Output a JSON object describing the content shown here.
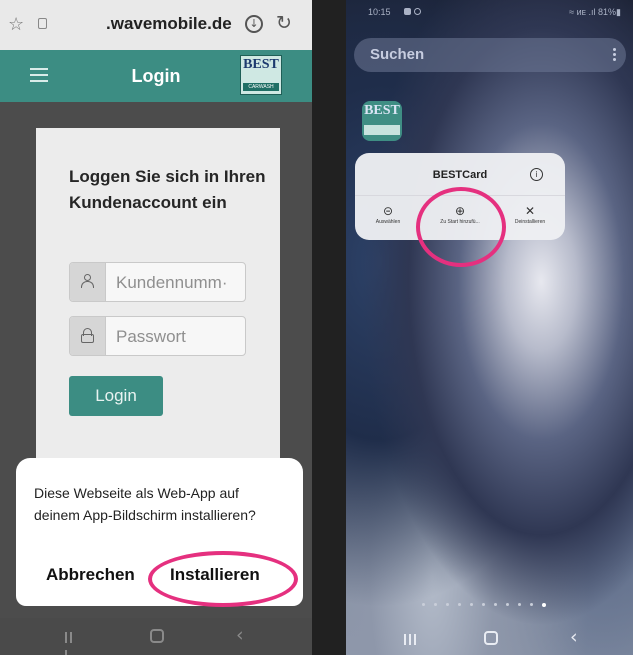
{
  "left_phone": {
    "address_bar": {
      "url": ".wavemobile.de"
    },
    "app_bar": {
      "title": "Login",
      "logo_text": "BEST",
      "logo_subtext": "CARWASH"
    },
    "login_card": {
      "heading": "Loggen Sie sich in Ihren Kundenaccount ein",
      "username_placeholder": "Kundennumm·",
      "password_placeholder": "Passwort",
      "login_button": "Login"
    },
    "install_dialog": {
      "message": "Diese Webseite als Web-App auf deinem App-Bildschirm installieren?",
      "cancel_button": "Abbrechen",
      "install_button": "Installieren"
    },
    "nav_bar": {
      "recents": "recents-icon",
      "home": "home-icon",
      "back": "back-icon"
    }
  },
  "right_phone": {
    "status_bar": {
      "time": "10:15",
      "system": "≈ ᴎᴇ .ıl 81%▮"
    },
    "search": {
      "placeholder": "Suchen"
    },
    "app_icon": {
      "text": "BEST"
    },
    "context_menu": {
      "app_name": "BESTCard",
      "actions": [
        {
          "icon": "⊝",
          "label": "Auswählen"
        },
        {
          "icon": "⊕",
          "label": "Zu Start hinzufü..."
        },
        {
          "icon": "✕",
          "label": "Deinstallieren"
        }
      ]
    },
    "page_indicator": {
      "count": 11,
      "active_index": 10
    }
  },
  "highlight_color": "#e5307f",
  "accent_color": "#3c8d83"
}
